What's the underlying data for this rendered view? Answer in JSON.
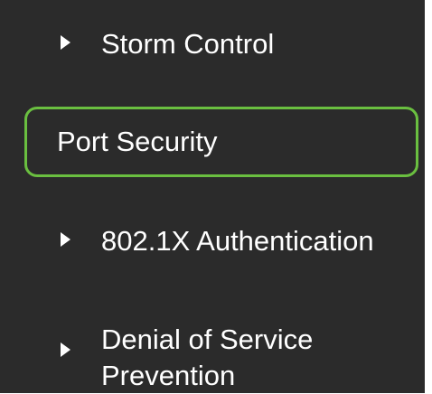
{
  "sidebar": {
    "items": [
      {
        "label": "Storm Control",
        "expandable": true,
        "selected": false
      },
      {
        "label": "Port Security",
        "expandable": false,
        "selected": true
      },
      {
        "label": "802.1X Authentication",
        "expandable": true,
        "selected": false
      },
      {
        "label": "Denial of Service Prevention",
        "expandable": true,
        "selected": false
      }
    ],
    "icons": {
      "expand": "caret-right-icon"
    },
    "colors": {
      "background": "#2b2b2b",
      "text": "#ffffff",
      "selected_border": "#6abf40"
    }
  }
}
